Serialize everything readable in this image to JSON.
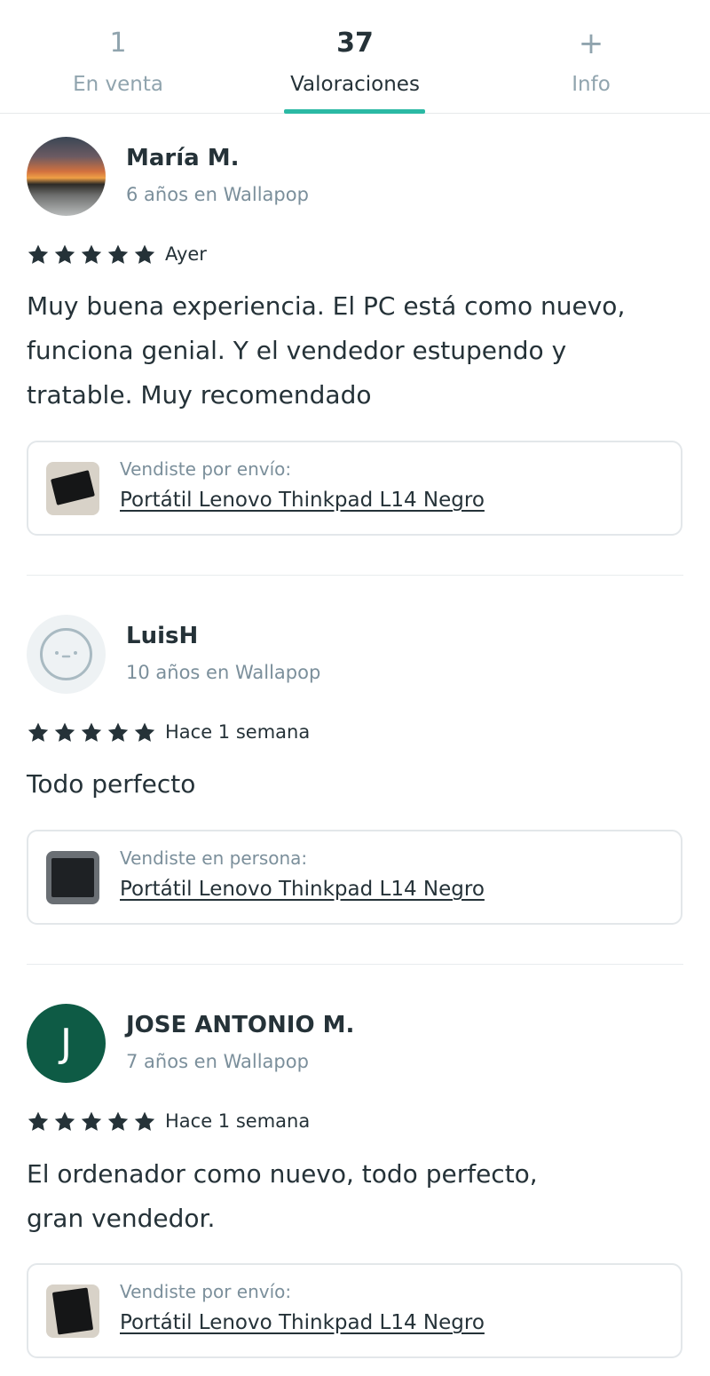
{
  "tabs": [
    {
      "count": "1",
      "label": "En venta",
      "active": false
    },
    {
      "count": "37",
      "label": "Valoraciones",
      "active": true
    },
    {
      "count": "+",
      "label": "Info",
      "active": false
    }
  ],
  "colors": {
    "accent": "#2bb9a4",
    "text": "#253238",
    "muted": "#7b8f9b",
    "avatar_green": "#0e5b45"
  },
  "reviews": [
    {
      "user": "María M.",
      "member_since": "6 años en Wallapop",
      "avatar": "photo-sunset",
      "rating": 5,
      "date": "Ayer",
      "text_lines": [
        "Muy buena experiencia. El PC está como nuevo,",
        "funciona genial. Y el vendedor estupendo y",
        "tratable. Muy recomendado"
      ],
      "item_meta": "Vendiste por envío:",
      "item_title": "Portátil Lenovo Thinkpad L14 Negro"
    },
    {
      "user": "LuisH",
      "member_since": "10 años en Wallapop",
      "avatar": "default-face-icon",
      "rating": 5,
      "date": "Hace 1 semana",
      "text_lines": [
        "Todo perfecto"
      ],
      "item_meta": "Vendiste en persona:",
      "item_title": "Portátil Lenovo Thinkpad L14 Negro"
    },
    {
      "user": "JOSE ANTONIO M.",
      "member_since": "7 años en Wallapop",
      "avatar_letter": "J",
      "rating": 5,
      "date": "Hace 1 semana",
      "text_lines": [
        "El ordenador como nuevo, todo perfecto,",
        "gran vendedor."
      ],
      "item_meta": "Vendiste por envío:",
      "item_title": "Portátil Lenovo Thinkpad L14 Negro"
    }
  ]
}
